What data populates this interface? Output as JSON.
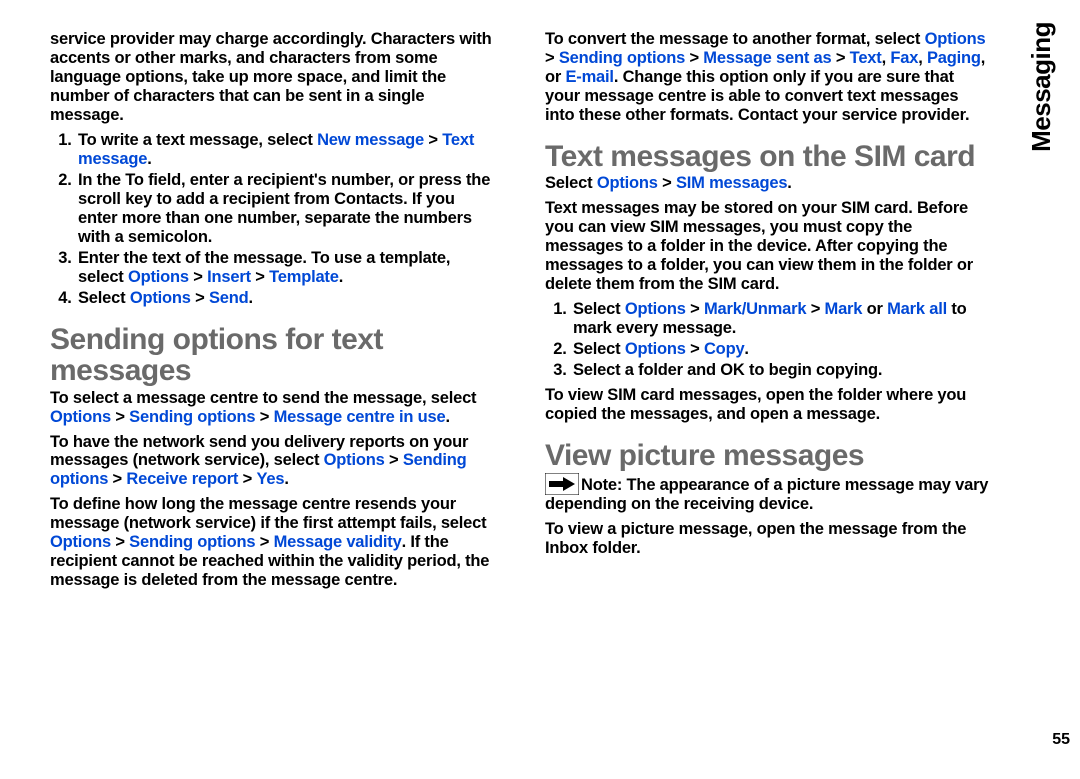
{
  "sideLabel": "Messaging",
  "pageNumber": "55",
  "left": {
    "intro": "service provider may charge accordingly. Characters with accents or other marks, and characters from some language options, take up more space, and limit the number of characters that can be sent in a single message.",
    "step1_a": "To write a text message, select ",
    "step1_b": "New message",
    "step1_c": " > ",
    "step1_d": "Text message",
    "step1_e": ".",
    "step2_a": "In the ",
    "step2_b": "To",
    "step2_c": " field, enter a recipient's number, or press the scroll key to add a recipient from Contacts. If you enter more than one number, separate the numbers with a semicolon.",
    "step3_a": "Enter the text of the message. To use a template, select ",
    "step3_b": "Options",
    "step3_c": " > ",
    "step3_d": "Insert",
    "step3_e": " > ",
    "step3_f": "Template",
    "step3_g": ".",
    "step4_a": "Select ",
    "step4_b": "Options",
    "step4_c": " > ",
    "step4_d": "Send",
    "step4_e": ".",
    "h_sending": "Sending options for text messages",
    "p2_a": "To select a message centre to send the message, select ",
    "p2_b": "Options",
    "p2_c": " > ",
    "p2_d": "Sending options",
    "p2_e": " > ",
    "p2_f": "Message centre in use",
    "p2_g": ".",
    "p3_a": "To have the network send you delivery reports on your messages (network service), select ",
    "p3_b": "Options",
    "p3_c": " > ",
    "p3_d": "Sending options",
    "p3_e": " > ",
    "p3_f": "Receive report",
    "p3_g": " > ",
    "p3_h": "Yes",
    "p3_i": ".",
    "p4_a": "To define how long the message centre resends your message (network service) if the first attempt fails, select ",
    "p4_b": "Options",
    "p4_c": " > ",
    "p4_d": "Sending options",
    "p4_e": " > ",
    "p4_f": "Message validity",
    "p4_g": ". If the recipient cannot be reached within the validity period, the message is deleted from the message centre."
  },
  "right": {
    "p1_a": "To convert the message to another format, select ",
    "p1_b": "Options",
    "p1_c": " > ",
    "p1_d": "Sending options",
    "p1_e": " > ",
    "p1_f": "Message sent as",
    "p1_g": " > ",
    "p1_h": "Text",
    "p1_i": ", ",
    "p1_j": "Fax",
    "p1_k": ", ",
    "p1_l": "Paging",
    "p1_m": ", or ",
    "p1_n": "E-mail",
    "p1_o": ". Change this option only if you are sure that your message centre is able to convert text messages into these other formats. Contact your service provider.",
    "h_sim": "Text messages on the SIM card",
    "p2_a": "Select ",
    "p2_b": "Options",
    "p2_c": " > ",
    "p2_d": "SIM messages",
    "p2_e": ".",
    "p3": "Text messages may be stored on your SIM card. Before you can view SIM messages, you must copy the messages to a folder in the device. After copying the messages to a folder, you can view them in the folder or delete them from the SIM card.",
    "s1_a": "Select ",
    "s1_b": "Options",
    "s1_c": " > ",
    "s1_d": "Mark/Unmark",
    "s1_e": " > ",
    "s1_f": "Mark",
    "s1_g": " or ",
    "s1_h": "Mark all",
    "s1_i": " to mark every message.",
    "s2_a": "Select ",
    "s2_b": "Options",
    "s2_c": " > ",
    "s2_d": "Copy",
    "s2_e": ".",
    "s3_a": "Select a folder and ",
    "s3_b": "OK",
    "s3_c": " to begin copying.",
    "p4": "To view SIM card messages, open the folder where you copied the messages, and open a message.",
    "h_view": "View picture messages",
    "note_a": "Note:",
    "note_b": " The appearance of a picture message may vary depending on the receiving device.",
    "p5": "To view a picture message, open the message from the Inbox folder."
  }
}
